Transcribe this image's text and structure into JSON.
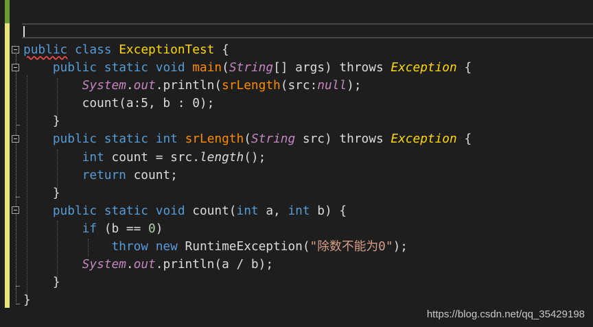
{
  "editor": {
    "lines": [
      [
        {
          "t": "public",
          "c": "kw squiggle"
        },
        {
          "t": " ",
          "c": "plain"
        },
        {
          "t": "class",
          "c": "kw"
        },
        {
          "t": " ",
          "c": "plain"
        },
        {
          "t": "ExceptionTest",
          "c": "cls-y"
        },
        {
          "t": " {",
          "c": "plain"
        }
      ],
      [
        {
          "t": "    ",
          "c": "plain"
        },
        {
          "t": "public",
          "c": "kw"
        },
        {
          "t": " ",
          "c": "plain"
        },
        {
          "t": "static",
          "c": "kw"
        },
        {
          "t": " ",
          "c": "plain"
        },
        {
          "t": "void",
          "c": "kw"
        },
        {
          "t": " ",
          "c": "plain"
        },
        {
          "t": "main",
          "c": "m"
        },
        {
          "t": "(",
          "c": "plain"
        },
        {
          "t": "String",
          "c": "type-i"
        },
        {
          "t": "[] args) ",
          "c": "plain"
        },
        {
          "t": "throws",
          "c": "plain"
        },
        {
          "t": " ",
          "c": "plain"
        },
        {
          "t": "Exception",
          "c": "exc"
        },
        {
          "t": " {",
          "c": "plain"
        }
      ],
      [
        {
          "t": "        ",
          "c": "plain"
        },
        {
          "t": "System",
          "c": "type-i"
        },
        {
          "t": ".",
          "c": "plain"
        },
        {
          "t": "out",
          "c": "field"
        },
        {
          "t": ".println(",
          "c": "plain"
        },
        {
          "t": "srLength",
          "c": "m"
        },
        {
          "t": "(src:",
          "c": "plain"
        },
        {
          "t": "null",
          "c": "null"
        },
        {
          "t": ");",
          "c": "plain"
        }
      ],
      [
        {
          "t": "        count(a:5, b : 0);",
          "c": "plain"
        }
      ],
      [
        {
          "t": "    }",
          "c": "plain"
        }
      ],
      [
        {
          "t": "    ",
          "c": "plain"
        },
        {
          "t": "public",
          "c": "kw"
        },
        {
          "t": " ",
          "c": "plain"
        },
        {
          "t": "static",
          "c": "kw"
        },
        {
          "t": " ",
          "c": "plain"
        },
        {
          "t": "int",
          "c": "kw"
        },
        {
          "t": " ",
          "c": "plain"
        },
        {
          "t": "srLength",
          "c": "m"
        },
        {
          "t": "(",
          "c": "plain"
        },
        {
          "t": "String",
          "c": "type-i"
        },
        {
          "t": " src) ",
          "c": "plain"
        },
        {
          "t": "throws",
          "c": "plain"
        },
        {
          "t": " ",
          "c": "plain"
        },
        {
          "t": "Exception",
          "c": "exc"
        },
        {
          "t": " {",
          "c": "plain"
        }
      ],
      [
        {
          "t": "        ",
          "c": "plain"
        },
        {
          "t": "int",
          "c": "kw"
        },
        {
          "t": " count = src.",
          "c": "plain"
        },
        {
          "t": "length",
          "c": "meth-i"
        },
        {
          "t": "();",
          "c": "plain"
        }
      ],
      [
        {
          "t": "        ",
          "c": "plain"
        },
        {
          "t": "return",
          "c": "kw"
        },
        {
          "t": " count;",
          "c": "plain"
        }
      ],
      [
        {
          "t": "    }",
          "c": "plain"
        }
      ],
      [
        {
          "t": "    ",
          "c": "plain"
        },
        {
          "t": "public",
          "c": "kw"
        },
        {
          "t": " ",
          "c": "plain"
        },
        {
          "t": "static",
          "c": "kw"
        },
        {
          "t": " ",
          "c": "plain"
        },
        {
          "t": "void",
          "c": "kw"
        },
        {
          "t": " count(",
          "c": "plain"
        },
        {
          "t": "int",
          "c": "kw"
        },
        {
          "t": " a, ",
          "c": "plain"
        },
        {
          "t": "int",
          "c": "kw"
        },
        {
          "t": " b) {",
          "c": "plain"
        }
      ],
      [
        {
          "t": "        ",
          "c": "plain"
        },
        {
          "t": "if",
          "c": "kw"
        },
        {
          "t": " (b == ",
          "c": "plain"
        },
        {
          "t": "0",
          "c": "num"
        },
        {
          "t": ")",
          "c": "plain"
        }
      ],
      [
        {
          "t": "            ",
          "c": "plain"
        },
        {
          "t": "throw",
          "c": "kw"
        },
        {
          "t": " ",
          "c": "plain"
        },
        {
          "t": "new",
          "c": "kw"
        },
        {
          "t": " RuntimeException(",
          "c": "plain"
        },
        {
          "t": "\"除数不能为0\"",
          "c": "str"
        },
        {
          "t": ");",
          "c": "plain"
        }
      ],
      [
        {
          "t": "        ",
          "c": "plain"
        },
        {
          "t": "System",
          "c": "type-i"
        },
        {
          "t": ".",
          "c": "plain"
        },
        {
          "t": "out",
          "c": "field"
        },
        {
          "t": ".println(a / b);",
          "c": "plain"
        }
      ],
      [
        {
          "t": "    }",
          "c": "plain"
        }
      ],
      [
        {
          "t": "}",
          "c": "plain"
        }
      ]
    ]
  },
  "watermark": "https://blog.csdn.net/qq_35429198",
  "colors": {
    "background": "#1e1e1e",
    "keyword": "#569cd6",
    "class_name": "#ffd700",
    "method": "#ff8c00",
    "type_italic": "#c586c0",
    "string": "#d69d85",
    "gutter_saved": "#6b9c34",
    "gutter_modified": "#e8e37a"
  }
}
